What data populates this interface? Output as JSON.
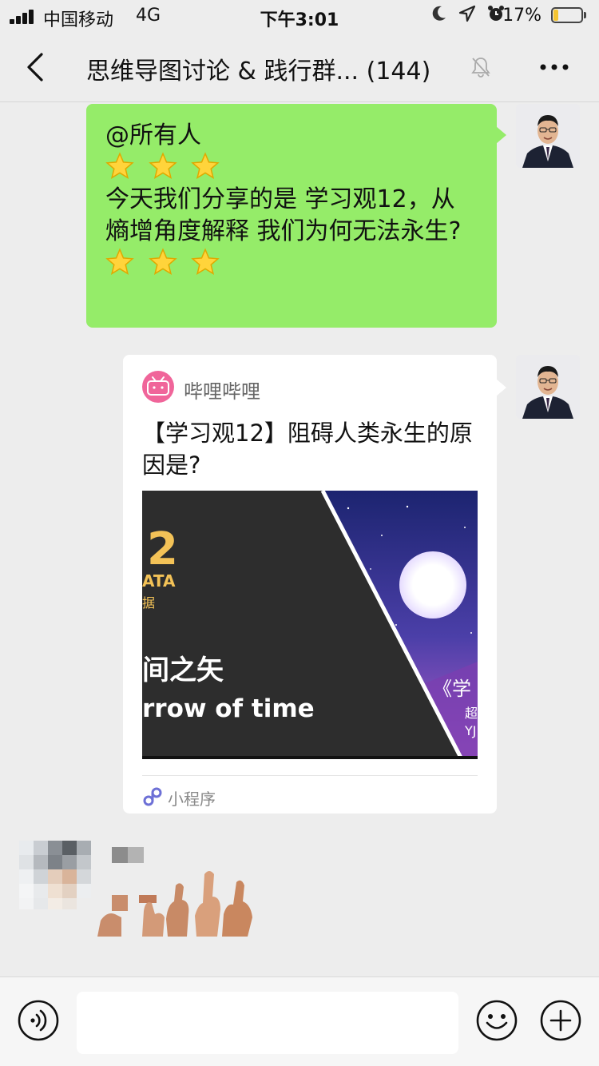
{
  "status_bar": {
    "carrier": "中国移动",
    "network": "4G",
    "time": "下午3:01",
    "battery_percent": "17%",
    "battery_level": 0.17
  },
  "nav": {
    "title": "思维导图讨论 & 践行群... (144)",
    "muted": true
  },
  "messages": [
    {
      "type": "text",
      "mention": "@所有人",
      "body": "今天我们分享的是 学习观12，从熵增角度解释 我们为何无法永生?",
      "stars_count": 3
    },
    {
      "type": "mini_program_card",
      "source": "哔哩哔哩",
      "title": "【学习观12】阻碍人类永生的原因是?",
      "thumb_text": {
        "number": "2",
        "tag1": "ATA",
        "tag2": "据",
        "cn": "间之矢",
        "en": "rrow of time",
        "side1": "《学",
        "side2": "超",
        "side3": "YJ"
      },
      "footer": "小程序"
    }
  ],
  "colors": {
    "bubble_green": "#95ec69",
    "background": "#ededed",
    "card_bg": "#ffffff"
  }
}
